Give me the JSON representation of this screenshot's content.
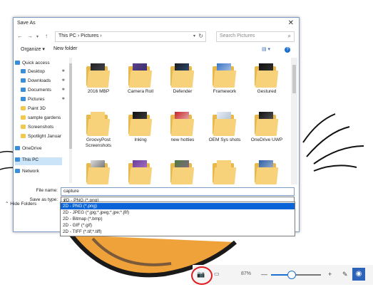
{
  "dialog": {
    "title": "Save As",
    "close_glyph": "✕",
    "breadcrumb": "This PC  ›  Pictures  ›",
    "search_placeholder": "Search Pictures",
    "toolbar": {
      "organize": "Organize ▾",
      "new_folder": "New folder"
    }
  },
  "sidebar": {
    "items": [
      {
        "label": "Quick access",
        "icon": "star-icon",
        "pinned": false
      },
      {
        "label": "Desktop",
        "icon": "desktop-icon",
        "pinned": true
      },
      {
        "label": "Downloads",
        "icon": "download-icon",
        "pinned": true
      },
      {
        "label": "Documents",
        "icon": "document-icon",
        "pinned": true
      },
      {
        "label": "Pictures",
        "icon": "picture-icon",
        "pinned": true
      },
      {
        "label": "Paint 3D",
        "icon": "folder-icon",
        "pinned": false
      },
      {
        "label": "sample gardens",
        "icon": "folder-icon",
        "pinned": false
      },
      {
        "label": "Screenshots",
        "icon": "folder-icon",
        "pinned": false
      },
      {
        "label": "Spotlight Januar",
        "icon": "folder-icon",
        "pinned": false
      },
      {
        "label": "OneDrive",
        "icon": "cloud-icon",
        "pinned": false
      },
      {
        "label": "This PC",
        "icon": "computer-icon",
        "pinned": false
      },
      {
        "label": "Network",
        "icon": "network-icon",
        "pinned": false
      }
    ]
  },
  "folders": [
    {
      "label": "2016 MBP"
    },
    {
      "label": "Camera Roll"
    },
    {
      "label": "Defender"
    },
    {
      "label": "Framework"
    },
    {
      "label": "Gestured"
    },
    {
      "label": "GroovyPost Screenshots"
    },
    {
      "label": "Inking"
    },
    {
      "label": "new hotties"
    },
    {
      "label": "OEM Sys shots"
    },
    {
      "label": "OneDrive UWP"
    },
    {
      "label": ""
    },
    {
      "label": ""
    },
    {
      "label": ""
    },
    {
      "label": ""
    },
    {
      "label": ""
    }
  ],
  "form": {
    "file_name_label": "File name:",
    "file_name_value": "capture",
    "save_type_label": "Save as type:",
    "save_type_value": "2D - PNG (*.png)"
  },
  "type_options": [
    "2D - PNG (*.png)",
    "2D - JPEG (*.jpg;*.jpeg;*.jpe;*.jfif)",
    "2D - Bitmap (*.bmp)",
    "2D - GIF (*.gif)",
    "2D - TIFF (*.tif;*.tiff)"
  ],
  "hide_folders": "Hide Folders",
  "host": {
    "zoom": "87%",
    "zoom_fraction": 0.4,
    "minus": "—",
    "plus": "+"
  },
  "colors": {
    "accent": "#1a6fd1",
    "highlight": "#e21b22",
    "selection": "#0a64d8"
  }
}
